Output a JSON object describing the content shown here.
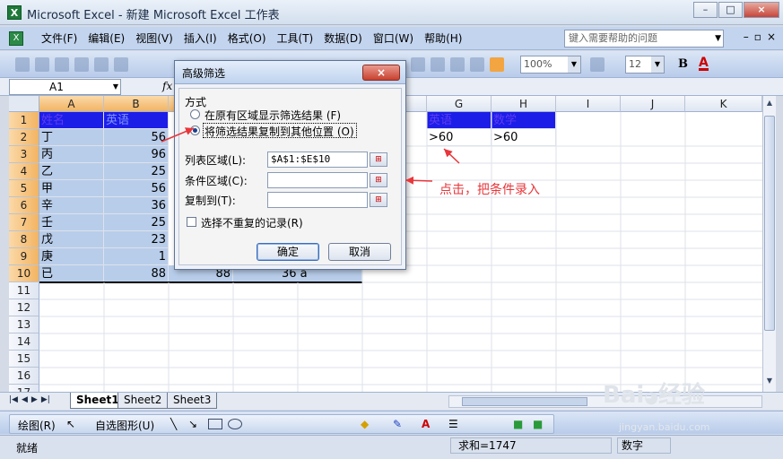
{
  "window": {
    "title": "Microsoft Excel - 新建 Microsoft Excel 工作表",
    "buttons": [
      "–",
      "□",
      "×"
    ]
  },
  "menubar": {
    "items": [
      "文件(F)",
      "编辑(E)",
      "视图(V)",
      "插入(I)",
      "格式(O)",
      "工具(T)",
      "数据(D)",
      "窗口(W)",
      "帮助(H)"
    ],
    "help_placeholder": "键入需要帮助的问题"
  },
  "toolbar": {
    "zoom": "100%",
    "font_size": "12",
    "bold_label": "B",
    "font_color_label": "A"
  },
  "formula_bar": {
    "name_box": "A1",
    "fx": "fx"
  },
  "grid": {
    "columns": [
      "A",
      "B",
      "",
      "",
      "",
      "",
      "G",
      "H",
      "I",
      "J",
      "K"
    ],
    "rows": [
      "1",
      "2",
      "3",
      "4",
      "5",
      "6",
      "7",
      "8",
      "9",
      "10",
      "11",
      "12",
      "13",
      "14",
      "15",
      "16",
      "17"
    ],
    "col_a": [
      "姓名",
      "丁",
      "丙",
      "乙",
      "甲",
      "辛",
      "壬",
      "戊",
      "庚",
      "已"
    ],
    "col_b": [
      "英语",
      "56",
      "96",
      "25",
      "56",
      "36",
      "25",
      "23",
      "1",
      "88"
    ],
    "row10_partial": [
      "88",
      "36 a"
    ],
    "col_g": [
      "英语",
      ">60"
    ],
    "col_h": [
      "数学",
      ">60"
    ]
  },
  "sheet_tabs": [
    "Sheet1",
    "Sheet2",
    "Sheet3"
  ],
  "drawbar": {
    "draw_label": "绘图(R)",
    "autoshape_label": "自选图形(U)"
  },
  "statusbar": {
    "ready": "就绪",
    "sum": "求和=1747",
    "num": "数字"
  },
  "dialog": {
    "title": "高级筛选",
    "close": "×",
    "section_label": "方式",
    "option1": "在原有区域显示筛选结果 (F)",
    "option2": "将筛选结果复制到其他位置 (O)",
    "selected_option": 2,
    "list_range_label": "列表区域(L):",
    "list_range_value": "$A$1:$E$10",
    "criteria_range_label": "条件区域(C):",
    "criteria_range_value": "",
    "copy_to_label": "复制到(T):",
    "copy_to_value": "",
    "unique_label": "选择不重复的记录(R)",
    "unique_checked": false,
    "ok_label": "确定",
    "cancel_label": "取消"
  },
  "annotation": {
    "text": "点击，把条件录入",
    "color": "#e8363b"
  },
  "watermark": {
    "text": "Bai¸经验",
    "sub": "jingyan.baidu.com"
  }
}
